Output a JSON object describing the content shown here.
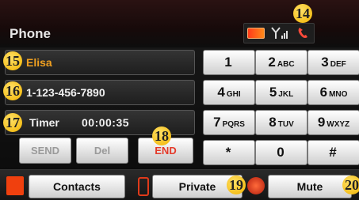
{
  "app": {
    "title": "Phone"
  },
  "status": {
    "battery_icon": "battery-icon",
    "signal_icon": "signal-icon",
    "call_icon": "phone-call-icon",
    "signal_text": "Yᴵᴵ"
  },
  "markers": {
    "m14": "14",
    "m15": "15",
    "m16": "16",
    "m17": "17",
    "m18": "18",
    "m19": "19",
    "m20": "20"
  },
  "call": {
    "name": "Elisa",
    "number": "1-123-456-7890",
    "timer_label": "Timer",
    "timer_value": "00:00:35"
  },
  "actions": {
    "send": "SEND",
    "del": "Del",
    "end": "END"
  },
  "keypad": [
    {
      "digit": "1",
      "letters": ""
    },
    {
      "digit": "2",
      "letters": "ABC"
    },
    {
      "digit": "3",
      "letters": "DEF"
    },
    {
      "digit": "4",
      "letters": "GHI"
    },
    {
      "digit": "5",
      "letters": "JKL"
    },
    {
      "digit": "6",
      "letters": "MNO"
    },
    {
      "digit": "7",
      "letters": "PQRS"
    },
    {
      "digit": "8",
      "letters": "TUV"
    },
    {
      "digit": "9",
      "letters": "WXYZ"
    },
    {
      "digit": "*",
      "letters": ""
    },
    {
      "digit": "0",
      "letters": ""
    },
    {
      "digit": "#",
      "letters": ""
    }
  ],
  "bottom": {
    "contacts": "Contacts",
    "private": "Private",
    "mute": "Mute"
  },
  "colors": {
    "accent": "#f0a020",
    "end": "#e43a2a",
    "marker": "#f1b300"
  }
}
